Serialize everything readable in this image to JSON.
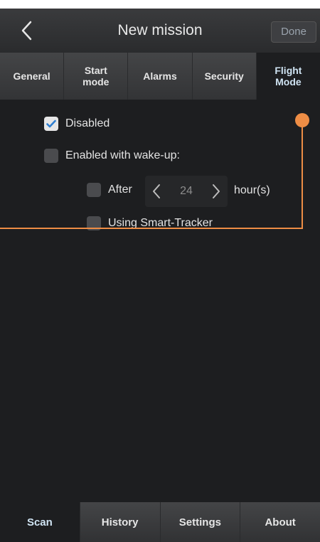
{
  "header": {
    "title": "New mission",
    "done_label": "Done"
  },
  "tabs": [
    {
      "label": "General",
      "active": false
    },
    {
      "label": "Start\nmode",
      "active": false
    },
    {
      "label": "Alarms",
      "active": false
    },
    {
      "label": "Security",
      "active": false
    },
    {
      "label": "Flight\nMode",
      "active": true
    }
  ],
  "flight_mode": {
    "disabled": {
      "label": "Disabled",
      "checked": true
    },
    "enabled_wakeup": {
      "label": "Enabled with wake-up:",
      "checked": false
    },
    "after": {
      "label": "After",
      "checked": false,
      "value": "24",
      "unit": "hour(s)"
    },
    "smart_tracker": {
      "label": "Using Smart-Tracker",
      "checked": false
    }
  },
  "bottom_nav": [
    {
      "label": "Scan",
      "active": true
    },
    {
      "label": "History",
      "active": false
    },
    {
      "label": "Settings",
      "active": false
    },
    {
      "label": "About",
      "active": false
    }
  ],
  "colors": {
    "annotation": "#ee8d45",
    "background": "#1d1e20",
    "accent_text": "#cfe3f2"
  },
  "icons": {
    "back": "chevron-left-icon",
    "prev": "chevron-left-icon",
    "next": "chevron-right-icon",
    "check": "checkmark-icon"
  }
}
